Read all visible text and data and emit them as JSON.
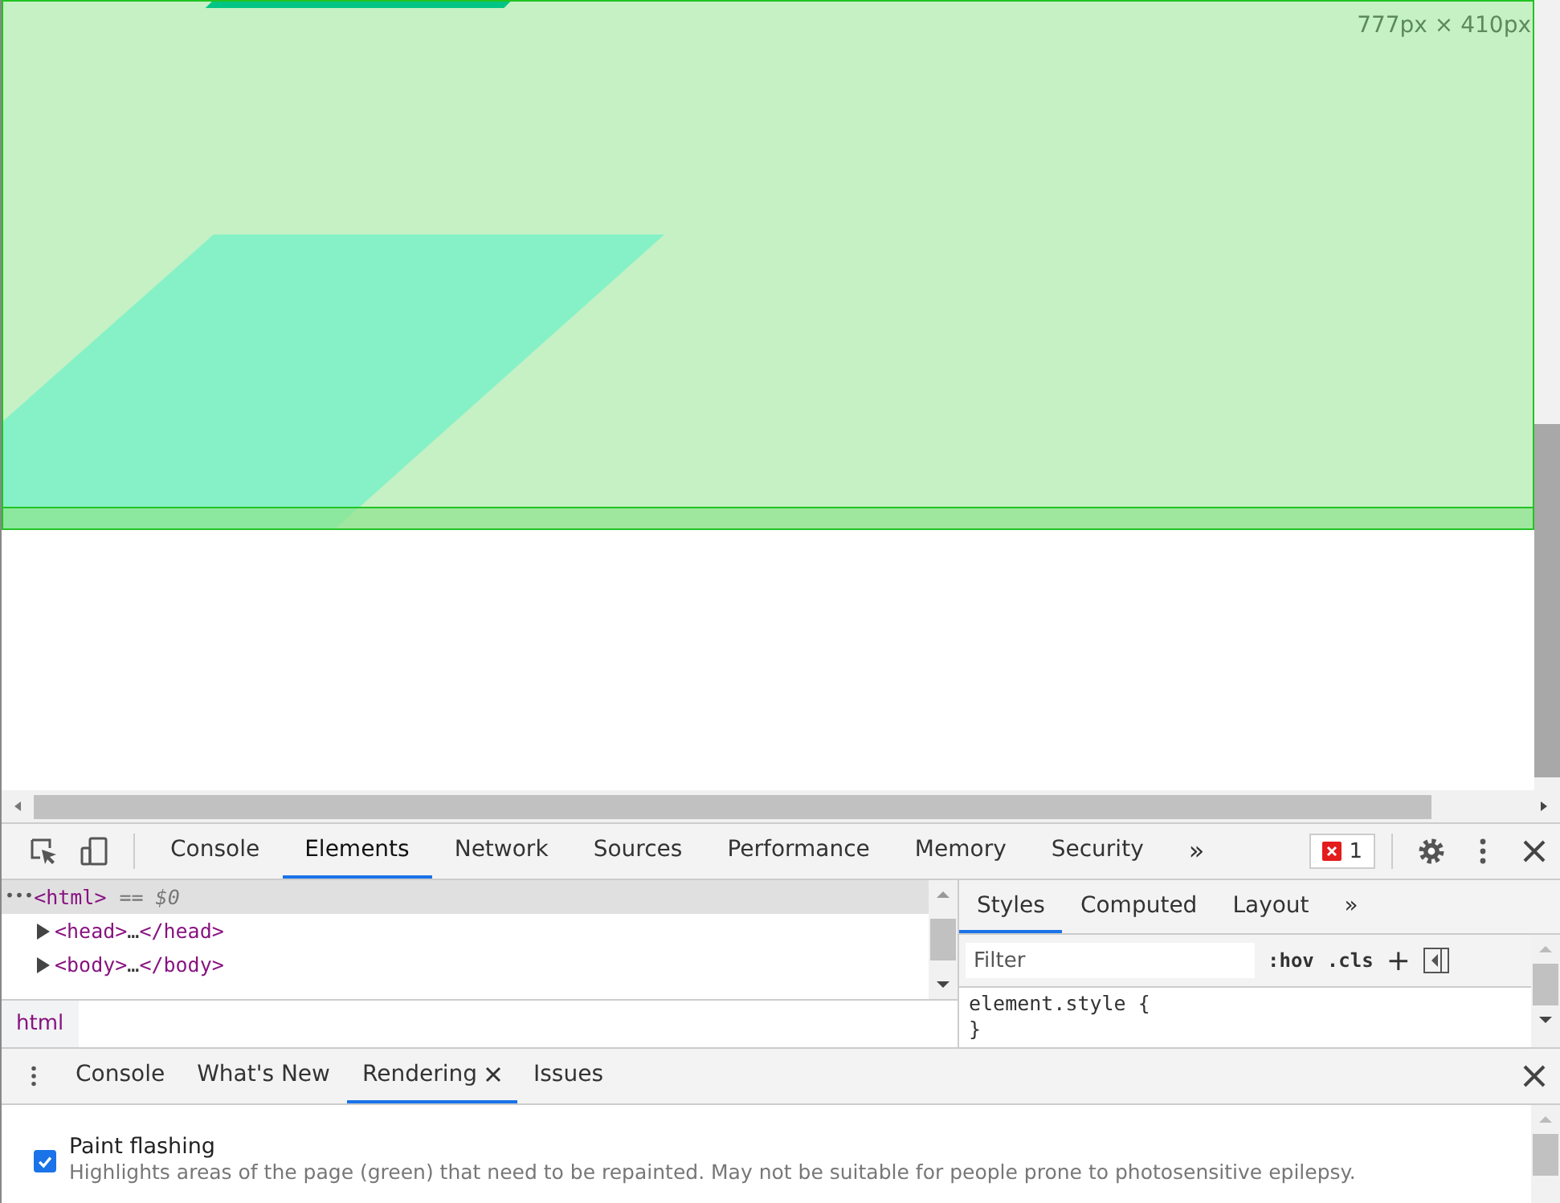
{
  "viewport": {
    "size_label": "777px × 410px"
  },
  "main_tabs": [
    {
      "label": "Console",
      "selected": false
    },
    {
      "label": "Elements",
      "selected": true
    },
    {
      "label": "Network",
      "selected": false
    },
    {
      "label": "Sources",
      "selected": false
    },
    {
      "label": "Performance",
      "selected": false
    },
    {
      "label": "Memory",
      "selected": false
    },
    {
      "label": "Security",
      "selected": false
    }
  ],
  "more_tabs": "»",
  "error_badge": {
    "count": "1"
  },
  "dom_tree": {
    "rows": [
      {
        "prefix": "•••",
        "open": "<html>",
        "note": "== $0",
        "selected": true,
        "expandable": false
      },
      {
        "open": "<head>",
        "dots": "…",
        "close": "</head>",
        "selected": false,
        "expandable": true
      },
      {
        "open": "<body>",
        "dots": "…",
        "close": "</body>",
        "selected": false,
        "expandable": true
      }
    ],
    "breadcrumb": "html"
  },
  "styles_pane": {
    "tabs": [
      {
        "label": "Styles",
        "selected": true
      },
      {
        "label": "Computed",
        "selected": false
      },
      {
        "label": "Layout",
        "selected": false
      }
    ],
    "more_tabs": "»",
    "filter": {
      "placeholder": "Filter"
    },
    "hov": ":hov",
    "cls": ".cls",
    "add": "+",
    "rule_open": "element.style {",
    "rule_close": "}"
  },
  "drawer": {
    "tabs": [
      {
        "label": "Console",
        "selected": false,
        "closable": false
      },
      {
        "label": "What's New",
        "selected": false,
        "closable": false
      },
      {
        "label": "Rendering",
        "selected": true,
        "closable": true
      },
      {
        "label": "Issues",
        "selected": false,
        "closable": false
      }
    ],
    "options": [
      {
        "title": "Paint flashing",
        "description": "Highlights areas of the page (green) that need to be repainted. May not be suitable for people prone to photosensitive epilepsy.",
        "checked": true
      }
    ]
  }
}
